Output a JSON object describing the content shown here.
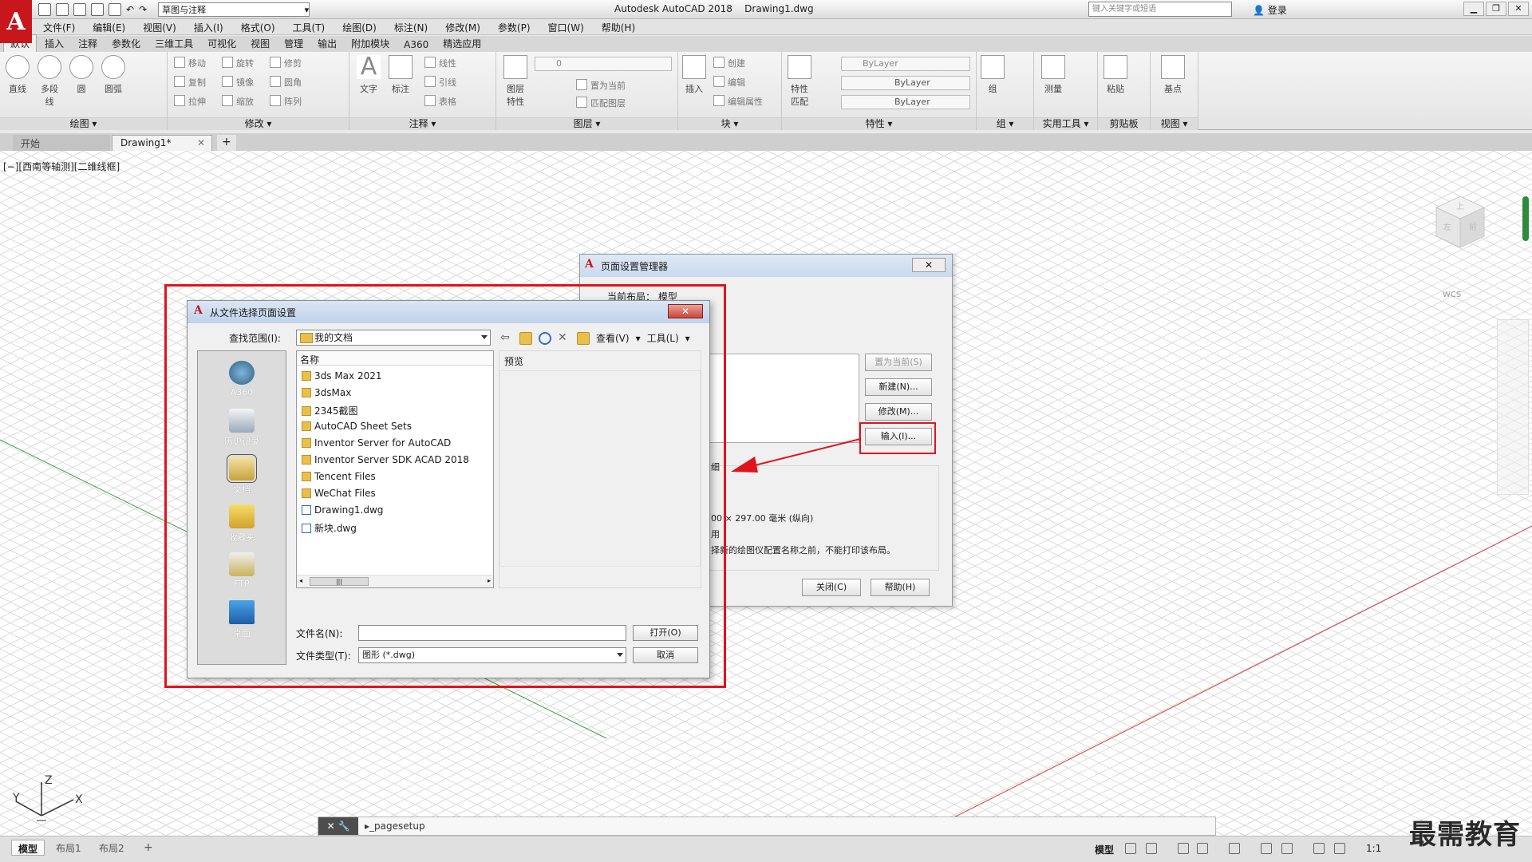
{
  "app": {
    "window_title": "Autodesk AutoCAD 2018    Drawing1.dwg",
    "workspace": "草图与注释",
    "search_placeholder": "键入关键字或短语",
    "login": "登录",
    "logo_letter": "A"
  },
  "menu": [
    "文件(F)",
    "编辑(E)",
    "视图(V)",
    "插入(I)",
    "格式(O)",
    "工具(T)",
    "绘图(D)",
    "标注(N)",
    "修改(M)",
    "参数(P)",
    "窗口(W)",
    "帮助(H)"
  ],
  "ribbon_tabs": [
    "默认",
    "插入",
    "注释",
    "参数化",
    "三维工具",
    "可视化",
    "视图",
    "管理",
    "输出",
    "附加模块",
    "A360",
    "精选应用"
  ],
  "ribbon": {
    "draw": {
      "title": "绘图 ▾",
      "tools": [
        "直线",
        "多段线",
        "圆",
        "圆弧"
      ]
    },
    "modify": {
      "title": "修改 ▾",
      "tools": [
        "移动",
        "旋转",
        "修剪",
        "复制",
        "镜像",
        "圆角",
        "拉伸",
        "缩放",
        "阵列"
      ]
    },
    "annotation": {
      "title": "注释 ▾",
      "tools": [
        "文字",
        "标注",
        "线性",
        "引线",
        "表格"
      ]
    },
    "layers": {
      "title": "图层 ▾",
      "tools": [
        "图层特性",
        "置为当前",
        "匹配图层"
      ],
      "current_layer": "0"
    },
    "block": {
      "title": "块 ▾",
      "tools": [
        "插入",
        "创建",
        "编辑",
        "编辑属性"
      ]
    },
    "properties": {
      "title": "特性 ▾",
      "tools": [
        "特性匹配"
      ],
      "color": "ByLayer",
      "linetype": "ByLayer",
      "lineweight": "ByLayer"
    },
    "groups": {
      "title": "组 ▾",
      "tools": [
        "组"
      ]
    },
    "utilities": {
      "title": "实用工具 ▾",
      "tools": [
        "测量"
      ]
    },
    "clipboard": {
      "title": "剪贴板",
      "tools": [
        "粘贴"
      ]
    },
    "view": {
      "title": "视图 ▾",
      "tools": [
        "基点"
      ]
    }
  },
  "doc_tabs": {
    "start": "开始",
    "drawing": "Drawing1*",
    "close": "✕",
    "add": "+"
  },
  "viewport_label": "[−][西南等轴测][二维线框]",
  "viewcube": {
    "top": "上",
    "front": "前",
    "left": "左"
  },
  "wcs": "WCS",
  "ucs": {
    "x": "X",
    "y": "Y",
    "z": "Z"
  },
  "command_line": {
    "text": "▸_pagesetup",
    "tools": "✕ 🔧"
  },
  "layout_tabs": [
    "模型",
    "布局1",
    "布局2",
    "+"
  ],
  "status": {
    "model": "模型",
    "scale": "1:1"
  },
  "watermark": "最需教育",
  "page_setup_manager": {
    "title": "页面设置管理器",
    "current_layout": "当前布局：    模型",
    "close_x": "✕",
    "buttons": {
      "set_current": "置为当前(S)",
      "new": "新建(N)...",
      "modify": "修改(M)...",
      "import": "输入(I)..."
    },
    "details": {
      "label": "细",
      "paper_size": "00 × 297.00 毫米  (纵向)",
      "where": "用",
      "note": "择新的绘图仪配置名称之前，不能打印该布局。"
    },
    "footer": {
      "close": "关闭(C)",
      "help": "帮助(H)"
    }
  },
  "file_dialog": {
    "title": "从文件选择页面设置",
    "close_x": "✕",
    "lookin_label": "查找范围(I):",
    "lookin_value": "我的文档",
    "toolbar": {
      "view": "查看(V)",
      "tools": "工具(L)"
    },
    "places": [
      "A360",
      "历史记录",
      "文档",
      "收藏夹",
      "FTP",
      "桌面"
    ],
    "column_name": "名称",
    "files": [
      {
        "name": "3ds Max 2021",
        "type": "folder"
      },
      {
        "name": "3dsMax",
        "type": "folder"
      },
      {
        "name": "2345截图",
        "type": "folder"
      },
      {
        "name": "AutoCAD Sheet Sets",
        "type": "folder"
      },
      {
        "name": "Inventor Server for AutoCAD",
        "type": "folder"
      },
      {
        "name": "Inventor Server SDK ACAD 2018",
        "type": "folder"
      },
      {
        "name": "Tencent Files",
        "type": "folder"
      },
      {
        "name": "WeChat Files",
        "type": "folder"
      },
      {
        "name": "Drawing1.dwg",
        "type": "dwg"
      },
      {
        "name": "新块.dwg",
        "type": "dwg"
      }
    ],
    "preview_label": "预览",
    "filename_label": "文件名(N):",
    "filename_value": "",
    "filetype_label": "文件类型(T):",
    "filetype_value": "图形 (*.dwg)",
    "open_button": "打开(O)",
    "cancel_button": "取消",
    "scroll_thumb": "|||"
  },
  "colors": {
    "accent_red": "#e0141b",
    "autocad_red": "#c8161d",
    "grid_line": "#d9d9d9",
    "axis_green": "#3ca03c",
    "axis_red": "#d23c3c"
  }
}
